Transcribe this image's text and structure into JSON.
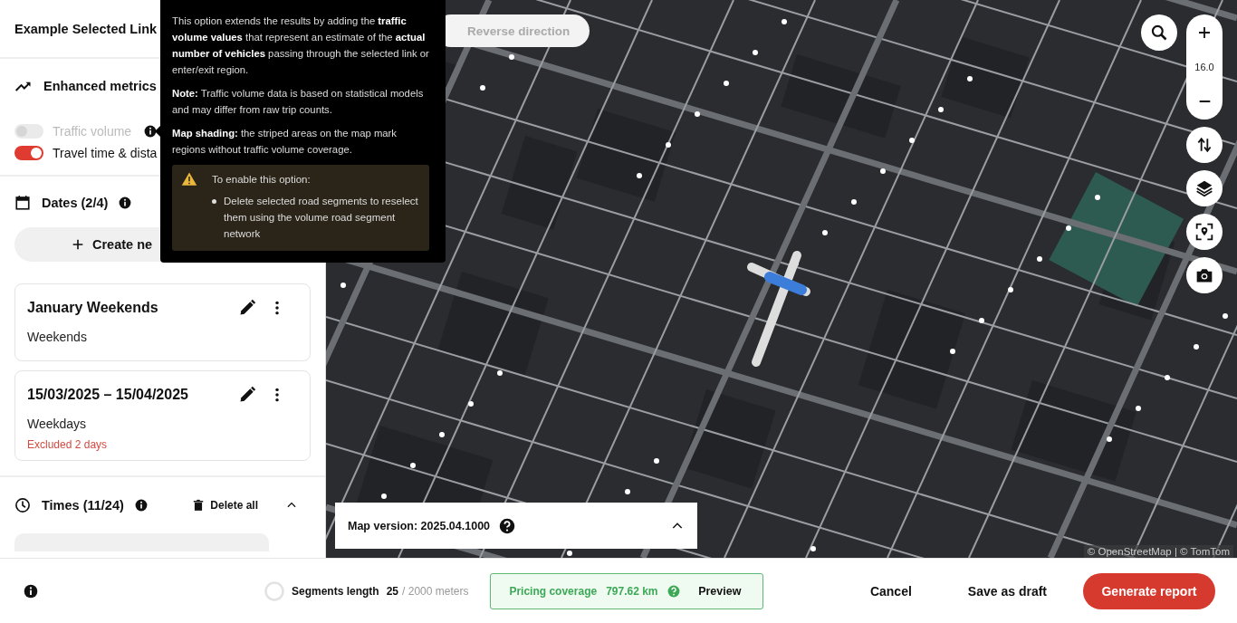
{
  "header": {
    "title": "Example Selected Link"
  },
  "metrics": {
    "title": "Enhanced metrics",
    "toggles": [
      {
        "label": "Traffic volume",
        "on": false,
        "disabled": true,
        "info": true
      },
      {
        "label": "Travel time & dista",
        "on": true,
        "disabled": false,
        "info": false
      }
    ]
  },
  "dates": {
    "title": "Dates (2/4)",
    "create_button": "Create ne",
    "cards": [
      {
        "title": "January Weekends",
        "subtitle": "Weekends"
      },
      {
        "title": "15/03/2025 – 15/04/2025",
        "subtitle": "Weekdays",
        "note": "Excluded 2 days"
      }
    ]
  },
  "times": {
    "title": "Times (11/24)",
    "delete_button": "Delete all"
  },
  "tooltip": {
    "paragraphs": [
      "This option extends the results by adding the **traffic volume values** that represent an estimate of the **actual number of vehicles** passing through the selected link or enter/exit region.",
      "**Note:** Traffic volume data is based on statistical models and may differ from raw trip counts.",
      "**Map shading:** the striped areas on the map mark regions without traffic volume coverage."
    ],
    "warning": {
      "title": "To enable this option:",
      "items": [
        "Delete selected road segments to reselect them using the volume road segment network"
      ]
    }
  },
  "map": {
    "reverse_button": {
      "label": "Reverse direction",
      "disabled": true
    },
    "zoom_level": "16.0",
    "map_version": "Map version: 2025.04.1000",
    "attribution": "© OpenStreetMap | © TomTom"
  },
  "footer": {
    "segments_label": "Segments length",
    "segments_value": "25",
    "segments_total": "/ 2000 meters",
    "pricing_label": "Pricing coverage",
    "pricing_value": "797.62 km",
    "preview": "Preview",
    "buttons": [
      {
        "label": "Cancel",
        "kind": "text"
      },
      {
        "label": "Save as draft",
        "kind": "text"
      },
      {
        "label": "Generate report",
        "kind": "primary"
      }
    ]
  }
}
